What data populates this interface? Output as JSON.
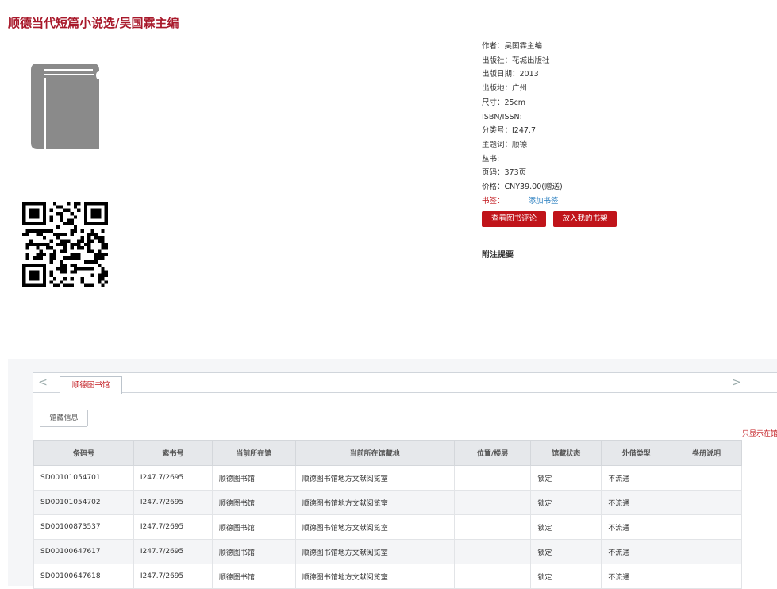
{
  "page": {
    "title": "顺德当代短篇小说选/吴国霖主编"
  },
  "meta": {
    "rows": [
      "作者：吴国霖主编",
      "出版社：花城出版社",
      "出版日期：2013",
      "出版地：广州",
      "尺寸：25cm",
      "ISBN/ISSN:",
      "分类号：I247.7",
      "主题词：顺德",
      "丛书:",
      "页码：373页",
      "价格：CNY39.00(赠送)"
    ],
    "bookmark_label": "书签：",
    "bookmark_link": "添加书签"
  },
  "buttons": {
    "view_reviews": "查看图书评论",
    "add_shelf": "放入我的书架"
  },
  "notes_label": "附注提要",
  "tabs": {
    "prev": "<",
    "next": ">",
    "library_tab": "顺德图书馆"
  },
  "holdings": {
    "subtab": "馆藏信息",
    "only_show": "只显示在馆",
    "columns": [
      "条码号",
      "索书号",
      "当前所在馆",
      "当前所在馆藏地",
      "位置/楼层",
      "馆藏状态",
      "外借类型",
      "卷册说明"
    ],
    "rows": [
      [
        "SD00101054701",
        "I247.7/2695",
        "顺德图书馆",
        "顺德图书馆地方文献阅览室",
        "",
        "锁定",
        "不流通",
        ""
      ],
      [
        "SD00101054702",
        "I247.7/2695",
        "顺德图书馆",
        "顺德图书馆地方文献阅览室",
        "",
        "锁定",
        "不流通",
        ""
      ],
      [
        "SD00100873537",
        "I247.7/2695",
        "顺德图书馆",
        "顺德图书馆地方文献阅览室",
        "",
        "锁定",
        "不流通",
        ""
      ],
      [
        "SD00100647617",
        "I247.7/2695",
        "顺德图书馆",
        "顺德图书馆地方文献阅览室",
        "",
        "锁定",
        "不流通",
        ""
      ],
      [
        "SD00100647618",
        "I247.7/2695",
        "顺德图书馆",
        "顺德图书馆地方文献阅览室",
        "",
        "锁定",
        "不流通",
        ""
      ]
    ]
  },
  "colors": {
    "accent": "#c0141a",
    "title": "#a8182a",
    "link": "#2a7fc0",
    "book_icon": "#8a8a8a"
  },
  "icons": {
    "cover": "book-icon",
    "qr": "qr-code"
  }
}
